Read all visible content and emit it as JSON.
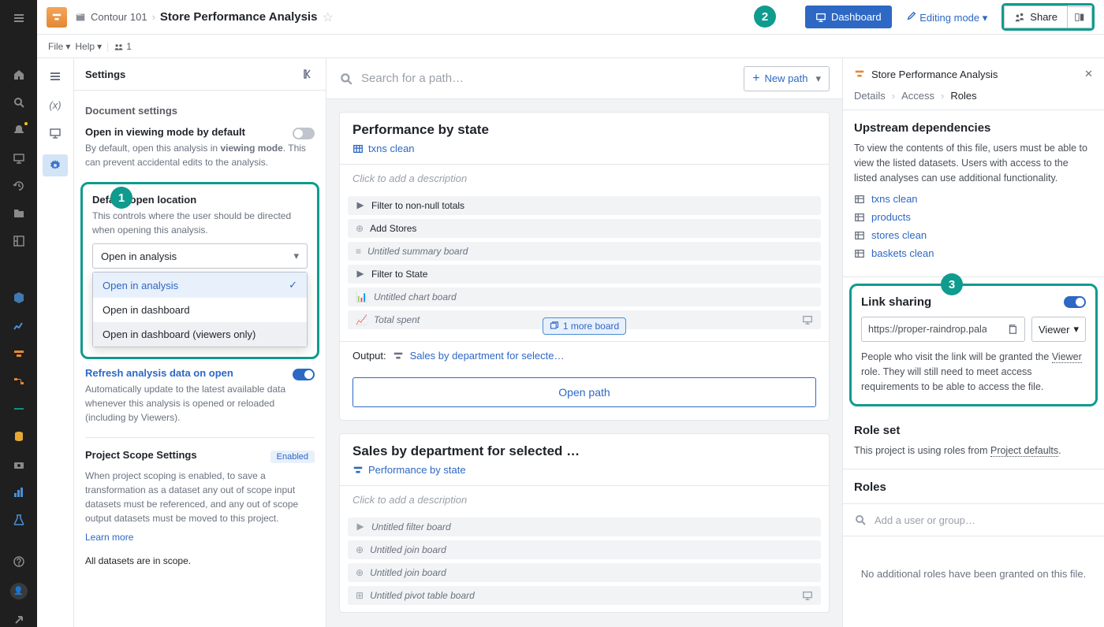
{
  "breadcrumb": {
    "folder": "Contour 101",
    "title": "Store Performance Analysis"
  },
  "menus": {
    "file": "File",
    "help": "Help",
    "people": "1"
  },
  "topbar": {
    "dashboard": "Dashboard",
    "editing": "Editing mode",
    "share": "Share"
  },
  "settings": {
    "heading": "Settings",
    "section1": "Document settings",
    "viewing": {
      "label": "Open in viewing mode by default",
      "desc_a": "By default, open this analysis in ",
      "desc_b": "viewing mode",
      "desc_c": ". This can prevent accidental edits to the analysis."
    },
    "location": {
      "label": "Default open location",
      "desc": "This controls where the user should be directed when opening this analysis.",
      "selected": "Open in analysis",
      "options": [
        "Open in analysis",
        "Open in dashboard",
        "Open in dashboard (viewers only)"
      ]
    },
    "refresh": {
      "label": "Refresh analysis data on open",
      "desc": "Automatically update to the latest available data whenever this analysis is opened or reloaded (including by Viewers)."
    },
    "scope": {
      "label": "Project Scope Settings",
      "badge": "Enabled",
      "desc": "When project scoping is enabled, to save a transformation as a dataset any out of scope input datasets must be referenced, and any out of scope output datasets must be moved to this project.",
      "learn": "Learn more",
      "footer": "All datasets are in scope."
    }
  },
  "canvas": {
    "search_placeholder": "Search for a path…",
    "newpath": "New path",
    "path1": {
      "title": "Performance by state",
      "source": "txns clean",
      "desc": "Click to add a description",
      "rows": [
        "Filter to non-null totals",
        "Add Stores",
        "Untitled summary board",
        "Filter to State",
        "Untitled chart board",
        "Total spent"
      ],
      "more": "1 more board",
      "output_label": "Output:",
      "output_val": "Sales by department for selecte…",
      "open": "Open path"
    },
    "path2": {
      "title": "Sales by department for selected …",
      "source": "Performance by state",
      "desc": "Click to add a description",
      "rows": [
        "Untitled filter board",
        "Untitled join board",
        "Untitled join board",
        "Untitled pivot table board"
      ]
    }
  },
  "side": {
    "title": "Store Performance Analysis",
    "crumbs": [
      "Details",
      "Access",
      "Roles"
    ],
    "upstream": {
      "title": "Upstream dependencies",
      "desc": "To view the contents of this file, users must be able to view the listed datasets. Users with access to the listed analyses can use additional functionality.",
      "datasets": [
        "txns clean",
        "products",
        "stores clean",
        "baskets clean"
      ]
    },
    "link": {
      "title": "Link sharing",
      "url": "https://proper-raindrop.palantir",
      "role": "Viewer",
      "help_a": "People who visit the link will be granted the ",
      "help_b": "Viewer",
      "help_c": " role. They will still need to meet access requirements to be able to access the file."
    },
    "roleset": {
      "title": "Role set",
      "desc_a": "This project is using roles from ",
      "desc_b": "Project defaults",
      "desc_c": "."
    },
    "roles": {
      "title": "Roles",
      "add": "Add a user or group…",
      "none": "No additional roles have been granted on this file."
    }
  },
  "callouts": {
    "n1": "1",
    "n2": "2",
    "n3": "3"
  }
}
